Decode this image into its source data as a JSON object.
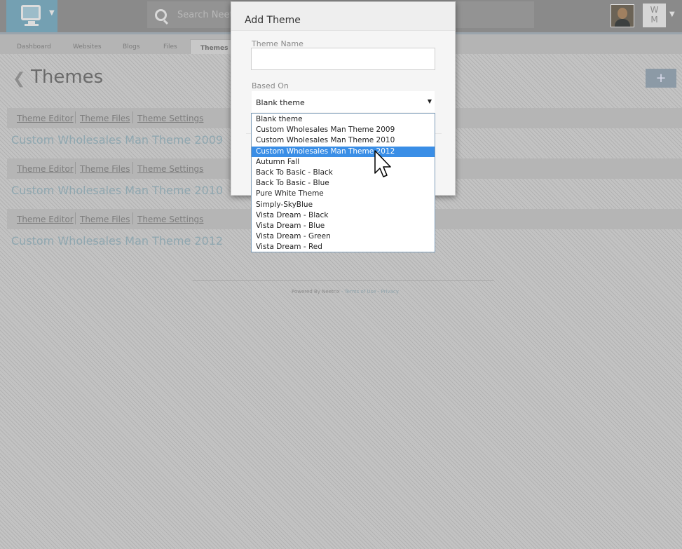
{
  "topbar": {
    "search_placeholder": "Search Neetr",
    "user_initials_top": "W",
    "user_initials_bottom": "M"
  },
  "subnav": {
    "tabs": [
      {
        "label": "Dashboard"
      },
      {
        "label": "Websites"
      },
      {
        "label": "Blogs"
      },
      {
        "label": "Files"
      },
      {
        "label": "Themes",
        "active": true
      }
    ]
  },
  "page": {
    "title": "Themes",
    "add_button": "+",
    "theme_links": {
      "editor": "Theme Editor",
      "files": "Theme Files",
      "settings": "Theme Settings"
    },
    "themes": [
      "Custom Wholesales Man Theme 2009",
      "Custom Wholesales Man Theme 2010",
      "Custom Wholesales Man Theme 2012"
    ]
  },
  "footer": {
    "powered_by": "Powered By Neetrix",
    "sep1": " - ",
    "terms": "Terms of Use",
    "sep2": " - ",
    "privacy": "Privacy"
  },
  "modal": {
    "title": "Add Theme",
    "theme_name_label": "Theme Name",
    "theme_name_value": "",
    "based_on_label": "Based On",
    "based_on_value": "Blank theme",
    "options": [
      "Blank theme",
      "Custom Wholesales Man Theme 2009",
      "Custom Wholesales Man Theme 2010",
      "Custom Wholesales Man Theme 2012",
      "Autumn Fall",
      "Back To Basic - Black",
      "Back To Basic - Blue",
      "Pure White Theme",
      "Simply-SkyBlue",
      "Vista Dream - Black",
      "Vista Dream - Blue",
      "Vista Dream - Green",
      "Vista Dream - Red"
    ],
    "highlighted_option_index": 3
  },
  "colors": {
    "accent": "#74a0b2",
    "selection": "#3a8ee6",
    "theme_title": "#8fa7b0"
  }
}
